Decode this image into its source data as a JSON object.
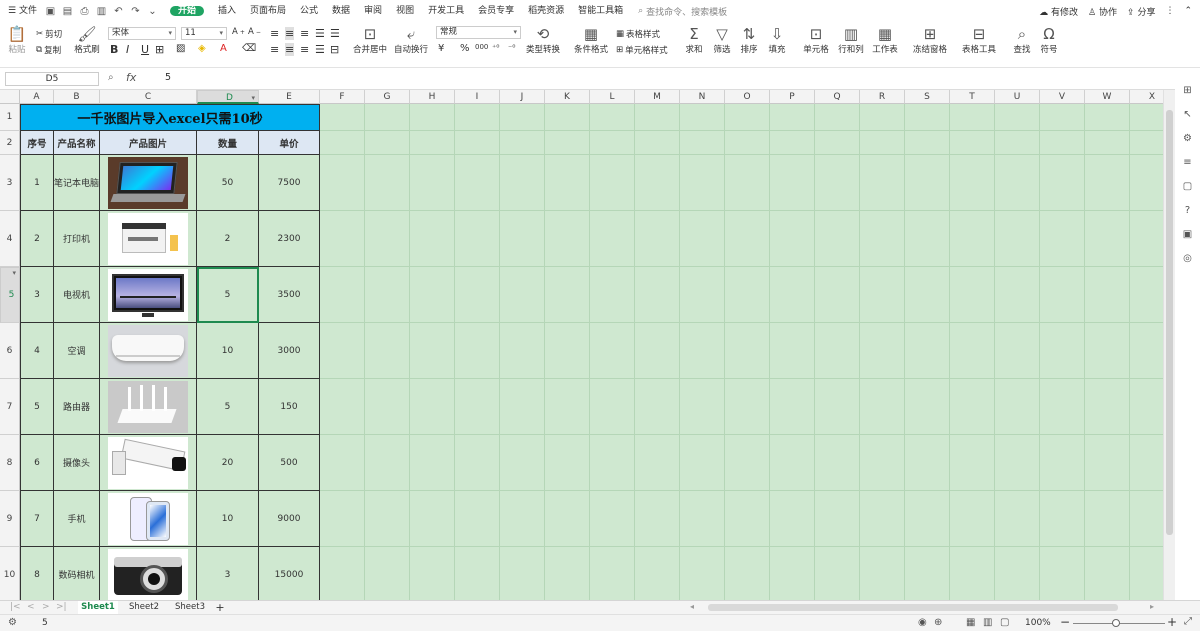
{
  "menubar": {
    "file": "文件",
    "items": [
      "开始",
      "插入",
      "页面布局",
      "公式",
      "数据",
      "审阅",
      "视图",
      "开发工具",
      "会员专享",
      "稻壳资源",
      "智能工具箱"
    ],
    "active": "开始",
    "search_placeholder": "查找命令、搜索模板",
    "right": {
      "modified": "有修改",
      "collab": "协作",
      "share": "分享"
    }
  },
  "ribbon": {
    "paste": "粘贴",
    "cut": "剪切",
    "copy": "复制",
    "format_painter": "格式刷",
    "font_name": "宋体",
    "font_size": "11",
    "merge_center": "合并居中",
    "wrap": "自动换行",
    "number_format": "常规",
    "type_convert": "类型转换",
    "cond_format": "条件格式",
    "table_style": "表格样式",
    "cell_style": "单元格样式",
    "sum": "求和",
    "filter": "筛选",
    "sort": "排序",
    "fill": "填充",
    "cell": "单元格",
    "rowcol": "行和列",
    "sheet": "工作表",
    "freeze": "冻结窗格",
    "table_tools": "表格工具",
    "find": "查找",
    "symbol": "符号",
    "bold": "B",
    "italic": "I",
    "underline": "U",
    "percent": "%",
    "thousands": "000",
    "yuan": "¥"
  },
  "formula_bar": {
    "name_box": "D5",
    "fx": "fx",
    "value": "5"
  },
  "columns": [
    "A",
    "B",
    "C",
    "D",
    "E",
    "F",
    "G",
    "H",
    "I",
    "J",
    "K",
    "L",
    "M",
    "N",
    "O",
    "P",
    "Q",
    "R",
    "S",
    "T",
    "U",
    "V",
    "W",
    "X"
  ],
  "selected_column": "D",
  "rows": [
    "1",
    "2",
    "3",
    "4",
    "5",
    "6",
    "7",
    "8",
    "9",
    "10"
  ],
  "selected_row": "5",
  "table": {
    "title": "一千张图片导入excel只需10秒",
    "headers": [
      "序号",
      "产品名称",
      "产品图片",
      "数量",
      "单价"
    ],
    "data": [
      {
        "id": "1",
        "name": "笔记本电脑",
        "image": "laptop-image",
        "qty": "50",
        "price": "7500"
      },
      {
        "id": "2",
        "name": "打印机",
        "image": "printer-image",
        "qty": "2",
        "price": "2300"
      },
      {
        "id": "3",
        "name": "电视机",
        "image": "tv-image",
        "qty": "5",
        "price": "3500"
      },
      {
        "id": "4",
        "name": "空调",
        "image": "air-conditioner-image",
        "qty": "10",
        "price": "3000"
      },
      {
        "id": "5",
        "name": "路由器",
        "image": "router-image",
        "qty": "5",
        "price": "150"
      },
      {
        "id": "6",
        "name": "摄像头",
        "image": "camera-image",
        "qty": "20",
        "price": "500"
      },
      {
        "id": "7",
        "name": "手机",
        "image": "phone-image",
        "qty": "10",
        "price": "9000"
      },
      {
        "id": "8",
        "name": "数码相机",
        "image": "digital-camera-image",
        "qty": "3",
        "price": "15000"
      }
    ]
  },
  "sheets": {
    "tabs": [
      "Sheet1",
      "Sheet2",
      "Sheet3"
    ],
    "active": "Sheet1",
    "add": "+"
  },
  "status": {
    "value": "5",
    "zoom": "100%",
    "minus": "−",
    "plus": "+"
  },
  "colors": {
    "accent": "#1fa463",
    "grid_bg": "#cfe8d0",
    "title_bg": "#00b0f0",
    "header_bg": "#dde7f3"
  }
}
